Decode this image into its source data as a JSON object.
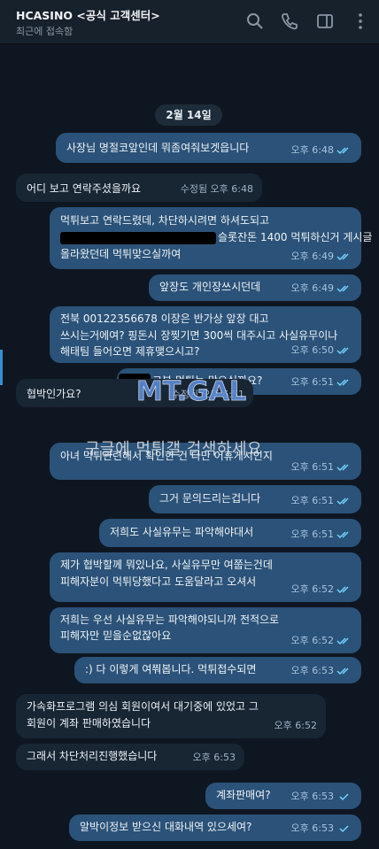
{
  "header": {
    "title": "HCASINO <공식 고객센터>",
    "status": "최근에 접속함",
    "icons": [
      "search-icon",
      "phone-icon",
      "sidebar-icon",
      "menu-icon"
    ]
  },
  "chat": {
    "date": "2월 14일",
    "messages": [
      {
        "text": "사장님 명절코앞인데 뭐좀여줘보겟읍니다",
        "time": "오후 6:48"
      },
      {
        "text": "어디 보고 연락주셨을까요",
        "time": "수정됨 오후 6:48"
      },
      {
        "text": "먹튀보고 연락드렸데, 차단하시려면 하셔도되고 / 슬롯잔돈 1400 먹튀하신거 게시글 올라왔던데 먹튀맞으실까여",
        "line1": "먹튀보고 연락드렸데, 차단하시려면 하셔도되고",
        "line2": "슬롯잔돈 1400 먹튀하신거 게시글",
        "line3": "올라왔던데 먹튀맞으실까여",
        "time": "오후 6:49"
      },
      {
        "text": "앞장도 개인장쓰시던데",
        "time": "오후 6:49"
      },
      {
        "line1": "전북 00122356678 이장은 반가상 앞장 대고",
        "line2": "쓰시는거에여? 핑돈시 장찢기면 300씩 대주시고 사실유무이나",
        "line3": "해태팀 들어오면 제휴맺으시고?",
        "time": "오후 6:50"
      },
      {
        "text": "그분 먹튀는 맞으실까요?",
        "time": "오후 6:51"
      },
      {
        "text": "협박인가요?",
        "time": "수정됨 오후 6:51"
      },
      {
        "text": "아녀 먹튀관련해서 확인한 건 다만 어휴게시인지",
        "time": "오후 6:51"
      },
      {
        "text": "그거 문의드리는겁니다",
        "time": "오후 6:51"
      },
      {
        "text": "저희도 사실유무는 파악해야대서",
        "time": "오후 6:51"
      },
      {
        "line1": "제가 협박할께 뭐있나요, 사실유무만 여쭙는건데",
        "line2": "피해자분이 먹튀당했다고 도움달라고 오셔서",
        "time": "오후 6:52"
      },
      {
        "line1": "저희는 우선 사실유무는 파악해야되니까 전적으로",
        "line2": "피해자만 믿을순없잖아요",
        "time": "오후 6:52"
      },
      {
        "text": ":) 다 이렇게 여쭤봅니다. 먹튀접수되면",
        "time": "오후 6:53"
      },
      {
        "line1": "가속화프로그램 의심 회원이여서 대기중에 있었고 그",
        "line2": "회원이 계좌 판매하였습니다",
        "time": "오후 6:52"
      },
      {
        "text": "그래서 차단처리진행했습니다",
        "time": "오후 6:53"
      },
      {
        "text": "계좌판매여?",
        "time": "오후 6:53"
      },
      {
        "text": "알박이정보 받으신 대화내역 있으세여?",
        "time": "오후 6:53"
      }
    ]
  },
  "watermark": {
    "logo": "MT.GAL",
    "text": "구글에 먹튀갤 검색하세요"
  },
  "colors": {
    "background": "#0e1621",
    "header": "#17212b",
    "incoming": "#182533",
    "outgoing": "#2b5278",
    "check": "#6fd3ff"
  }
}
